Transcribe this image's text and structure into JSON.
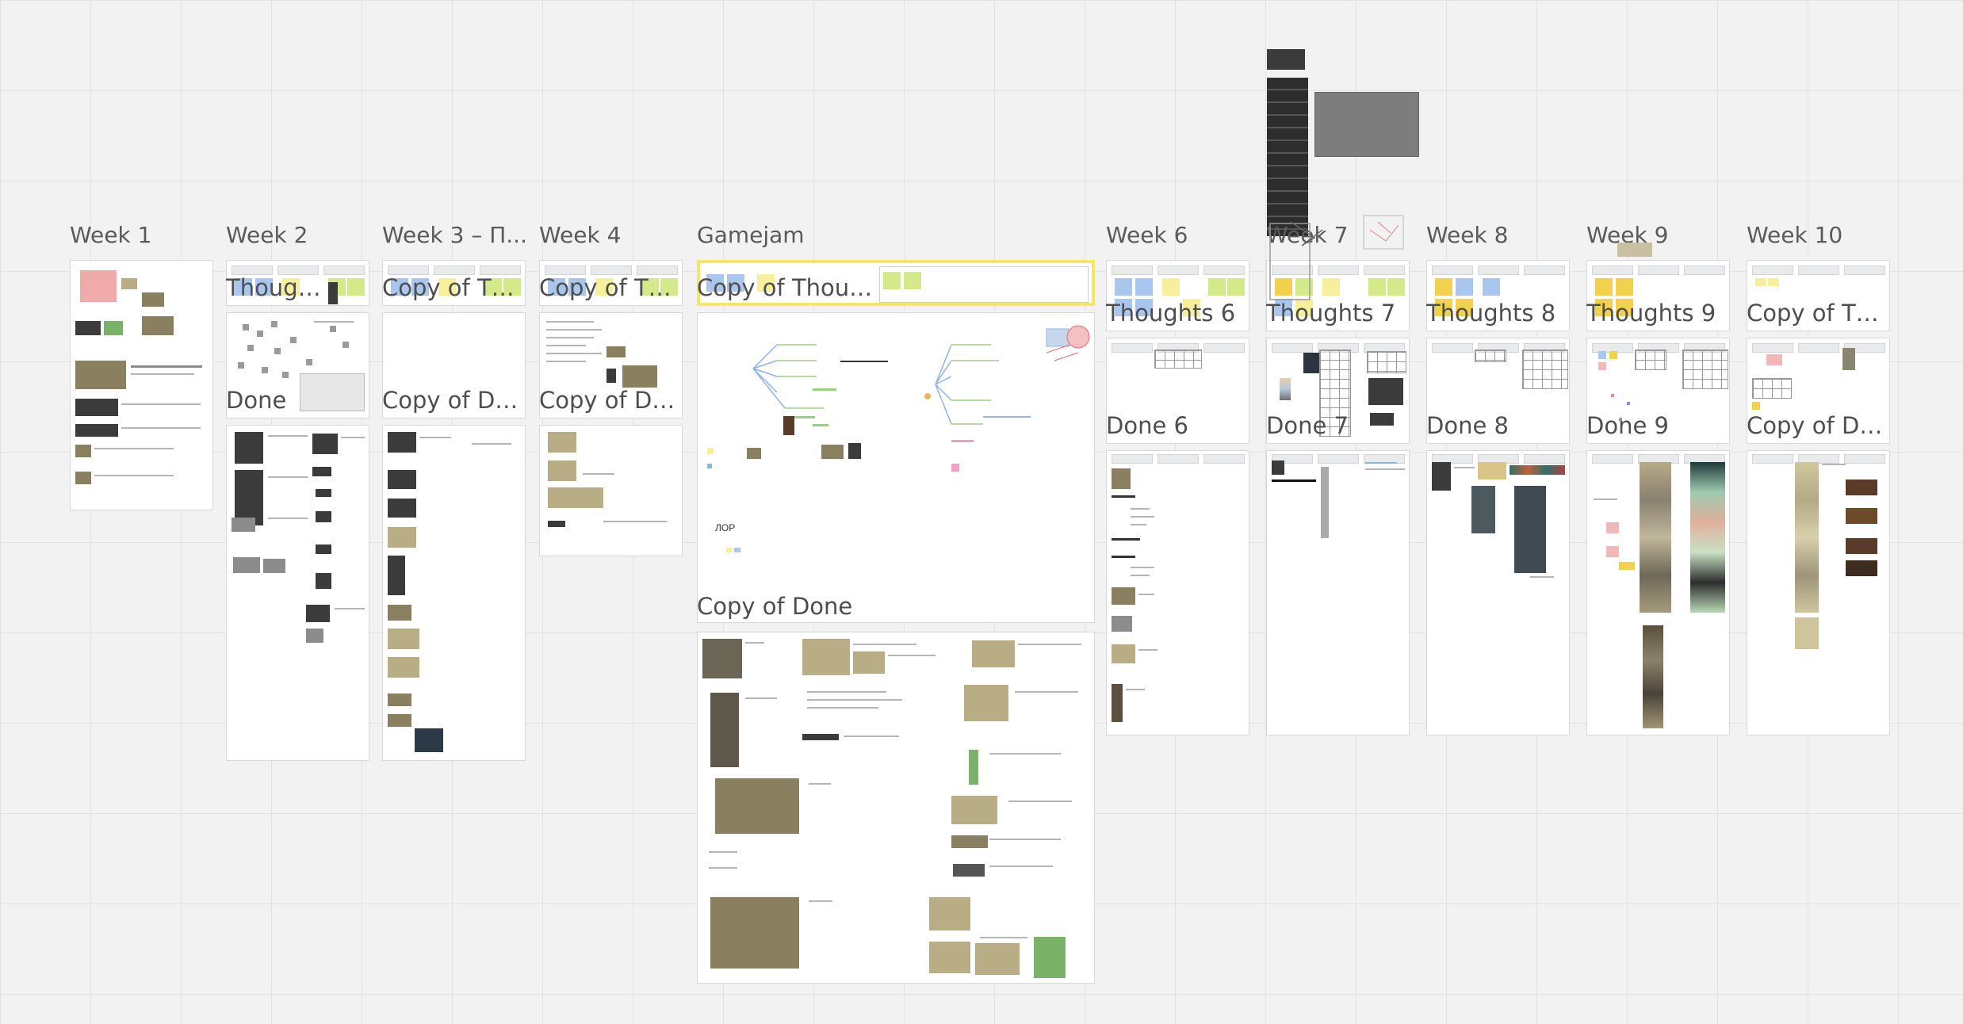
{
  "board": {
    "columns": [
      {
        "title": "Week 1",
        "thoughts": "",
        "done": ""
      },
      {
        "title": "Week 2",
        "thoughts": "Thoughts",
        "done": "Done"
      },
      {
        "title": "Week 3 – П...",
        "thoughts": "Copy of Tho...",
        "done": "Copy of Done"
      },
      {
        "title": "Week 4",
        "thoughts": "Copy of Tho...",
        "done": "Copy of Done"
      },
      {
        "title": "Gamejam",
        "thoughts": "Copy of Thoughts",
        "done": "Copy of Done"
      },
      {
        "title": "Week 6",
        "thoughts": "Thoughts 6",
        "done": "Done 6"
      },
      {
        "title": "Week 7",
        "thoughts": "Thoughts 7",
        "done": "Done 7"
      },
      {
        "title": "Week 8",
        "thoughts": "Thoughts 8",
        "done": "Done 8"
      },
      {
        "title": "Week 9",
        "thoughts": "Thoughts 9",
        "done": "Done 9"
      },
      {
        "title": "Week 10",
        "thoughts": "Copy of Tho...",
        "done": "Copy of Do..."
      }
    ],
    "gamejam_note": "ЛОР"
  },
  "colors": {
    "canvas": "#f2f2f2",
    "grid": "#e2e2e2",
    "sticky_blue": "#a9c6ee",
    "sticky_yellow": "#f7ef9b",
    "sticky_green": "#d4ea8a",
    "selection": "#f5e663"
  }
}
